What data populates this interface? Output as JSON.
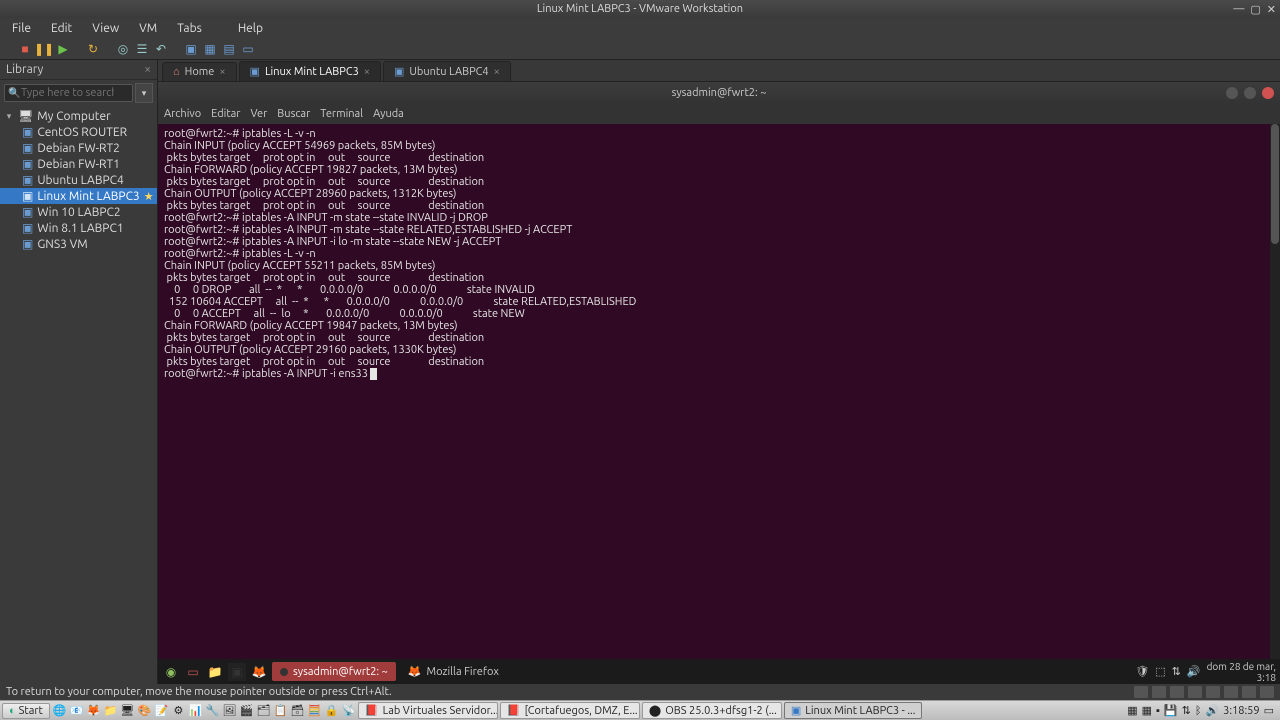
{
  "titlebar": {
    "title": "Linux Mint LABPC3 - VMware Workstation"
  },
  "menubar": [
    "File",
    "Edit",
    "View",
    "VM",
    "Tabs",
    "Help"
  ],
  "library": {
    "title": "Library",
    "search_placeholder": "Type here to search",
    "root": "My Computer",
    "items": [
      "CentOS ROUTER",
      "Debian FW-RT2",
      "Debian FW-RT1",
      "Ubuntu LABPC4",
      "Linux Mint LABPC3",
      "Win 10 LABPC2",
      "Win 8.1 LABPC1",
      "GNS3 VM"
    ],
    "selected_index": 4
  },
  "tabs": [
    {
      "icon": "home",
      "label": "Home",
      "active": false
    },
    {
      "icon": "vm",
      "label": "Linux Mint LABPC3",
      "active": true
    },
    {
      "icon": "vm",
      "label": "Ubuntu LABPC4",
      "active": false
    }
  ],
  "guest_terminal": {
    "title": "sysadmin@fwrt2: ~",
    "menu": [
      "Archivo",
      "Editar",
      "Ver",
      "Buscar",
      "Terminal",
      "Ayuda"
    ],
    "lines": [
      "root@fwrt2:~# iptables -L -v -n",
      "Chain INPUT (policy ACCEPT 54969 packets, 85M bytes)",
      " pkts bytes target     prot opt in     out     source               destination",
      "",
      "Chain FORWARD (policy ACCEPT 19827 packets, 13M bytes)",
      " pkts bytes target     prot opt in     out     source               destination",
      "",
      "Chain OUTPUT (policy ACCEPT 28960 packets, 1312K bytes)",
      " pkts bytes target     prot opt in     out     source               destination",
      "root@fwrt2:~# iptables -A INPUT -m state --state INVALID -j DROP",
      "root@fwrt2:~# iptables -A INPUT -m state --state RELATED,ESTABLISHED -j ACCEPT",
      "root@fwrt2:~# iptables -A INPUT -i lo -m state --state NEW -j ACCEPT",
      "root@fwrt2:~# iptables -L -v -n",
      "Chain INPUT (policy ACCEPT 55211 packets, 85M bytes)",
      " pkts bytes target     prot opt in     out     source               destination",
      "    0     0 DROP       all  --  *      *       0.0.0.0/0            0.0.0.0/0            state INVALID",
      "  152 10604 ACCEPT     all  --  *      *       0.0.0.0/0            0.0.0.0/0            state RELATED,ESTABLISHED",
      "    0     0 ACCEPT     all  --  lo     *       0.0.0.0/0            0.0.0.0/0            state NEW",
      "",
      "Chain FORWARD (policy ACCEPT 19847 packets, 13M bytes)",
      " pkts bytes target     prot opt in     out     source               destination",
      "",
      "Chain OUTPUT (policy ACCEPT 29160 packets, 1330K bytes)",
      " pkts bytes target     prot opt in     out     source               destination"
    ],
    "current_prompt": "root@fwrt2:~# iptables -A INPUT -i ens33 "
  },
  "guest_panel": {
    "tasks": [
      {
        "label": "sysadmin@fwrt2: ~",
        "active": true
      },
      {
        "label": "Mozilla Firefox",
        "active": false
      }
    ],
    "clock_date": "dom 28 de mar,",
    "clock_time": "3:18"
  },
  "statusbar": {
    "hint": "To return to your computer, move the mouse pointer outside or press Ctrl+Alt."
  },
  "host_taskbar": {
    "start": "Start",
    "tasks": [
      "Lab Virtuales Servidor...",
      "[Cortafuegos, DMZ, E...",
      "OBS 25.0.3+dfsg1-2 (...",
      "Linux Mint LABPC3 - ..."
    ],
    "active_task_index": 3,
    "clock_time": "3:18:59"
  }
}
